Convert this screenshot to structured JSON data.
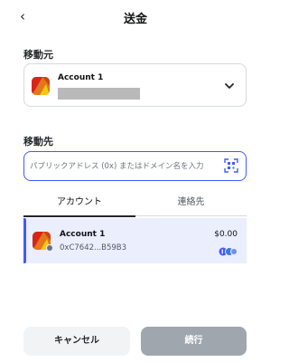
{
  "header": {
    "title": "送金",
    "back_glyph": "‹"
  },
  "from": {
    "label": "移動元",
    "account_name": "Account 1"
  },
  "to": {
    "label": "移動先",
    "search_placeholder": "パブリックアドレス (0x) またはドメイン名を入力"
  },
  "tabs": [
    {
      "label": "アカウント",
      "active": true
    },
    {
      "label": "連絡先",
      "active": false
    }
  ],
  "accounts": [
    {
      "name": "Account 1",
      "address": "0xC7642...B59B3",
      "balance": "$0.00"
    }
  ],
  "footer": {
    "cancel_label": "キャンセル",
    "continue_label": "続行"
  },
  "colors": {
    "accent": "#4459ff",
    "selected_row": "#eaeefd",
    "continue_disabled": "#9fa6ae"
  },
  "icons": [
    "back-arrow-icon",
    "metamask-fox-icon",
    "chevron-down-icon",
    "qr-scan-icon",
    "network-badge-icon"
  ]
}
